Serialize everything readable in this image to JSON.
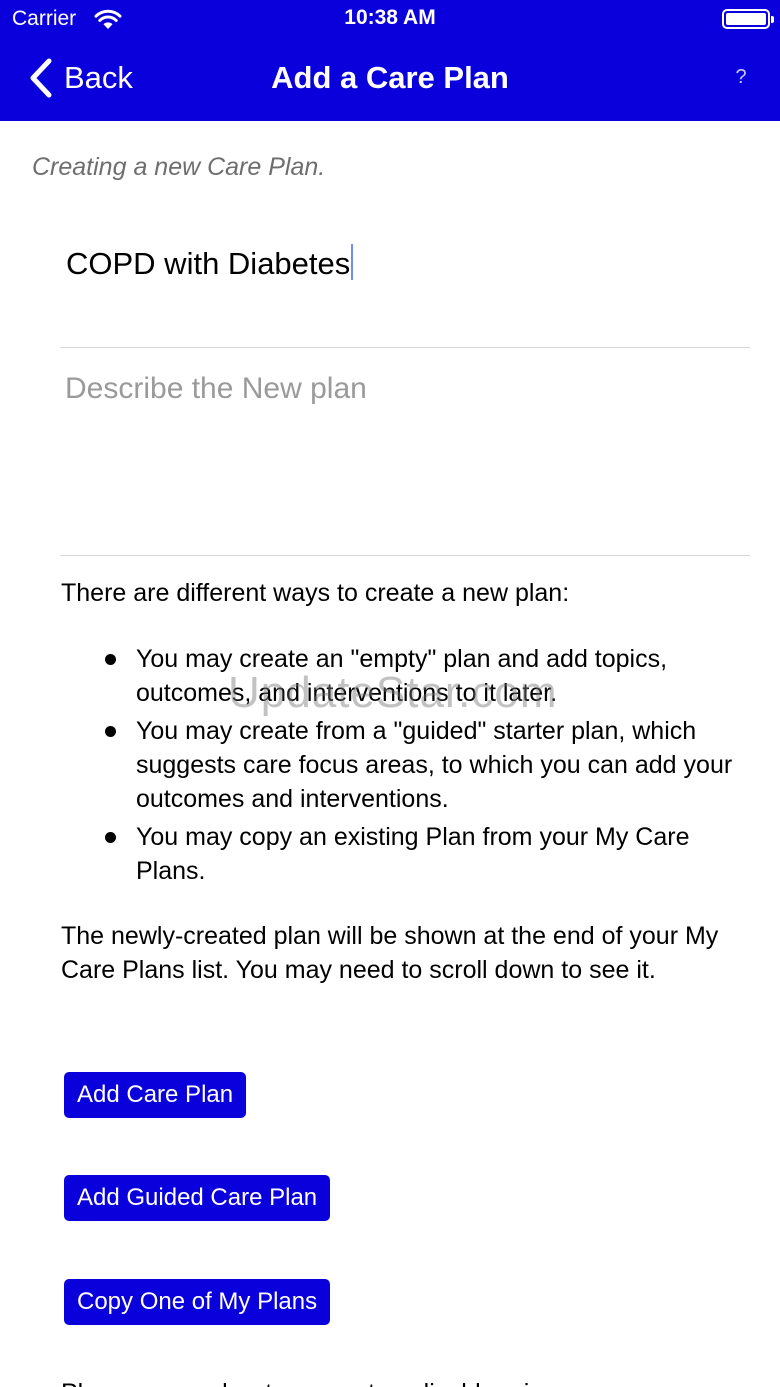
{
  "status_bar": {
    "carrier": "Carrier",
    "time": "10:38 AM"
  },
  "nav": {
    "back_label": "Back",
    "title": "Add a Care Plan",
    "help_label": "?"
  },
  "form": {
    "subtitle": "Creating a new Care Plan.",
    "plan_name_value": "COPD with Diabetes",
    "description_placeholder": "Describe the New plan"
  },
  "info": {
    "intro": "There are different ways to create a new plan:",
    "bullets": [
      "You may create an \"empty\" plan and add topics, outcomes, and interventions to it later.",
      "You may create from a \"guided\" starter plan, which suggests care focus areas, to which you can add your outcomes and interventions.",
      "You may copy an existing Plan from your My Care Plans."
    ],
    "note": "The newly-created plan will be shown at the end of your My Care Plans list. You may need to scroll down to see it.",
    "partial_line": "Please remember to respect applicable privacy"
  },
  "buttons": {
    "add": "Add Care Plan",
    "add_guided": "Add Guided Care Plan",
    "copy": "Copy One of My Plans"
  },
  "watermark": "UpdateStar.com",
  "colors": {
    "nav_background": "#0a00dc",
    "button_background": "#0a00dc",
    "caret": "#6e8bff"
  },
  "icons": {
    "back": "chevron-left-icon",
    "wifi": "wifi-icon",
    "battery": "battery-icon"
  }
}
